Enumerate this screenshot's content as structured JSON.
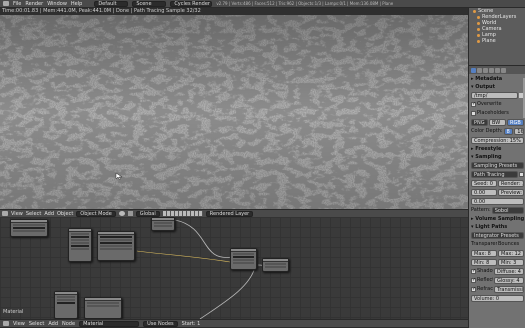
{
  "topbar": {
    "menus": [
      "File",
      "Render",
      "Window",
      "Help"
    ],
    "screen": "Default",
    "scene": "Scene",
    "engine": "Cycles Render",
    "stats": "v2.79 | Verts:486 | Faces:512 | Tris:962 | Objects:1/3 | Lamps:0/1 | Mem:136.08M | Plane"
  },
  "infobar": {
    "text": "Time:00:01.83 | Mem:441.0M, Peak:441.0M | Done | Path Tracing Sample 32/32"
  },
  "viewport_header": {
    "menus": [
      "View",
      "Select",
      "Add",
      "Object"
    ],
    "mode": "Object Mode",
    "pivot": "Global",
    "layer_label": "Rendered Layer"
  },
  "node_editor": {
    "label": "Material",
    "footer": {
      "menus": [
        "View",
        "Select",
        "Add",
        "Node"
      ],
      "material": "Material",
      "use_nodes": "Use Nodes"
    }
  },
  "outliner": {
    "items": [
      "Scene",
      "RenderLayers",
      "World",
      "Camera",
      "Lamp",
      "Plane"
    ]
  },
  "properties": {
    "metadata": "Metadata",
    "output": "Output",
    "output_path": "/tmp/",
    "overwrite": "Overwrite",
    "file_ext": "File Extensions",
    "placeholders": "Placeholders",
    "cache": "Cache Result",
    "format_png": "PNG",
    "bw": "BW",
    "rgb": "RGB",
    "rgba": "RGBA",
    "color_depth_label": "Color Depth:",
    "depth_8": "8",
    "depth_16": "16",
    "compression": "Compression: 15%",
    "freestyle": "Freestyle",
    "sampling": "Sampling",
    "sampling_preset": "Sampling Presets",
    "path_tracing": "Path Tracing",
    "square_samples": "Square Samples",
    "settings_label": "Settings:",
    "samples_label": "Samples:",
    "seed": "Seed: 0",
    "render": "Render: 10",
    "clamp_direct": "0.00",
    "clamp_indirect": "0.00",
    "preview": "Preview: 10",
    "pattern_label": "Pattern:",
    "pattern": "Sobol",
    "volume_sampling": "Volume Sampling",
    "light_paths": "Light Paths",
    "integrator_preset": "Integrator Presets",
    "transparency": "Transparency",
    "bounces": "Bounces",
    "max_t": "Max: 8",
    "min_t": "Min: 8",
    "shadows": "Shadows",
    "reflective": "Reflective Caustics",
    "refractive": "Refractive Caustics",
    "max_b": "Max: 12",
    "min_b": "Min: 3",
    "diffuse_b": "Diffuse: 4",
    "glossy_b": "Glossy: 4",
    "trans_b": "Transmission: 12",
    "volume_b": "Volume: 0"
  },
  "bottombar": {
    "frame": "Start: 1"
  }
}
